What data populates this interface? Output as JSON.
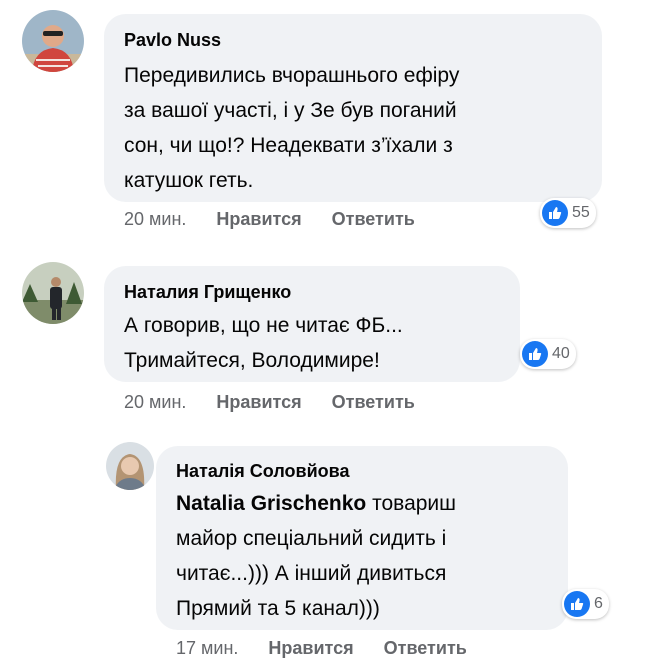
{
  "comments": [
    {
      "author": "Pavlo Nuss",
      "lines": [
        "Передивились вчорашнього ефіру",
        "за вашої участі, і у Зе був поганий",
        "сон, чи що!? Неадеквати з’їхали з",
        "катушок геть."
      ],
      "time": "20 мин.",
      "like_label": "Нравится",
      "reply_label": "Ответить",
      "reactions": "55"
    },
    {
      "author": "Наталия Грищенко",
      "lines": [
        "А говорив, що не читає ФБ...",
        "Тримайтеся, Володимире!"
      ],
      "time": "20 мин.",
      "like_label": "Нравится",
      "reply_label": "Ответить",
      "reactions": "40"
    },
    {
      "author": "Наталія Соловйова",
      "mention": "Natalia Grischenko",
      "line1_rest": " товариш",
      "lines": [
        "майор спеціальний сидить і",
        "читає...))) А інший дивиться",
        "Прямий та 5 канал)))"
      ],
      "time": "17 мин.",
      "like_label": "Нравится",
      "reply_label": "Ответить",
      "reactions": "6"
    }
  ],
  "colors": {
    "bubble": "#f0f2f5",
    "meta": "#65676b",
    "like": "#1877f2"
  }
}
